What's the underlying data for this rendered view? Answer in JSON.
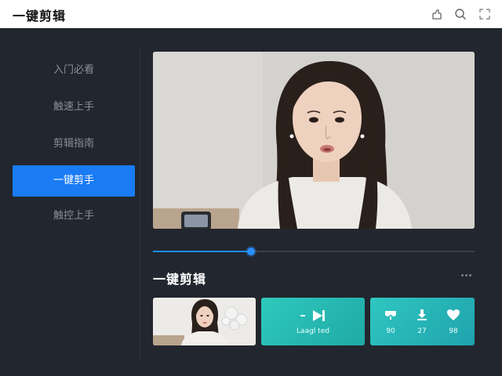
{
  "app": {
    "title": "一键剪辑",
    "icons": [
      "share-icon",
      "search-icon",
      "expand-icon"
    ]
  },
  "sidebar": {
    "items": [
      {
        "label": "入门必看",
        "active": false
      },
      {
        "label": "触速上手",
        "active": false
      },
      {
        "label": "剪辑指南",
        "active": false
      },
      {
        "label": "一键剪手",
        "active": true
      },
      {
        "label": "触控上手",
        "active": false
      }
    ]
  },
  "player": {
    "progress": 0.305
  },
  "section": {
    "title": "一键剪辑"
  },
  "cards": {
    "action": {
      "label": "Laagl ted"
    },
    "stats": [
      {
        "icon": "mask-icon",
        "value": "90"
      },
      {
        "icon": "download-icon",
        "value": "27"
      },
      {
        "icon": "heart-icon",
        "value": "98"
      }
    ]
  },
  "colors": {
    "accent": "#1a7cf5",
    "teal": "#26b8b0",
    "background": "#22262e"
  }
}
